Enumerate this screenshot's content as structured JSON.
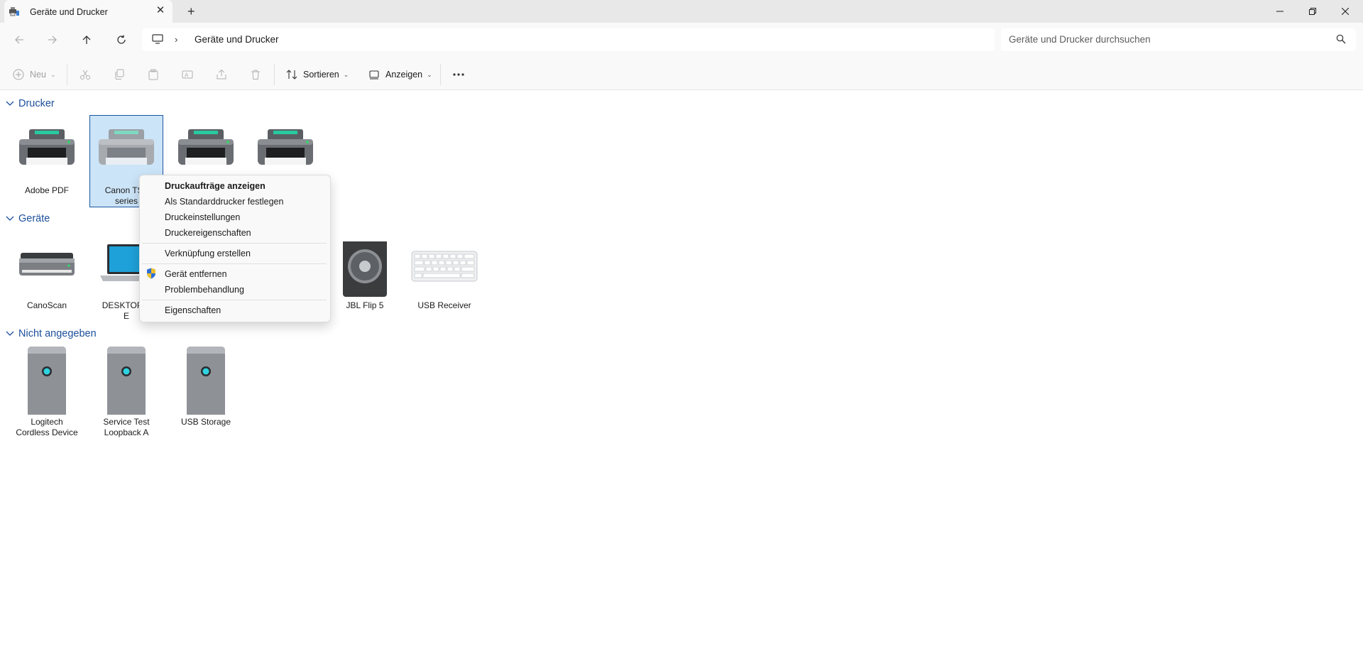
{
  "window": {
    "tab_title": "Geräte und Drucker",
    "tab_icon": "devices-printers-icon",
    "new_tab_label": "+"
  },
  "address": {
    "path_item": "Geräte und Drucker",
    "search_placeholder": "Geräte und Drucker durchsuchen"
  },
  "toolbar": {
    "new_label": "Neu",
    "sort_label": "Sortieren",
    "view_label": "Anzeigen"
  },
  "groups": {
    "printers": {
      "title": "Drucker",
      "items": [
        {
          "line1": "Adobe PDF",
          "line2": ""
        },
        {
          "line1": "Canon TS6",
          "line2": "series"
        },
        {
          "line1": "",
          "line2": ""
        },
        {
          "line1": "",
          "line2": ""
        }
      ]
    },
    "devices": {
      "title": "Geräte",
      "items": [
        {
          "line1": "CanoScan",
          "line2": ""
        },
        {
          "line1": "DESKTOP-T",
          "line2": "E"
        },
        {
          "line1": "JBL Flip 5",
          "line2": ""
        },
        {
          "line1": "USB Receiver",
          "line2": ""
        }
      ]
    },
    "unspecified": {
      "title": "Nicht angegeben",
      "items": [
        {
          "line1": "Logitech",
          "line2": "Cordless Device"
        },
        {
          "line1": "Service Test",
          "line2": "Loopback A"
        },
        {
          "line1": "USB Storage",
          "line2": ""
        }
      ]
    }
  },
  "context_menu": {
    "items": [
      {
        "label": "Druckaufträge anzeigen",
        "bold": true
      },
      {
        "label": "Als Standarddrucker festlegen"
      },
      {
        "label": "Druckeinstellungen"
      },
      {
        "label": "Druckereigenschaften"
      },
      {
        "label": "Verknüpfung erstellen"
      },
      {
        "label": "Gerät entfernen",
        "icon": "uac-shield-icon"
      },
      {
        "label": "Problembehandlung"
      },
      {
        "label": "Eigenschaften"
      }
    ]
  },
  "colors": {
    "accent": "#1c4f9c",
    "selection_fill": "#cce4f7",
    "selection_border": "#1a57a3"
  }
}
